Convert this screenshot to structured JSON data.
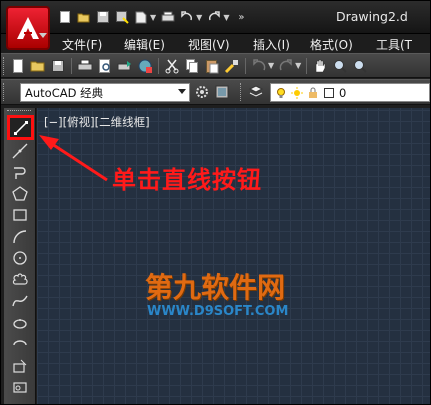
{
  "window": {
    "title": "Drawing2.d",
    "app_logo": "autocad-a-logo"
  },
  "quick_access": [
    "new-icon",
    "open-icon",
    "save-icon",
    "saveas-icon",
    "publish-icon",
    "print-icon",
    "undo-icon",
    "redo-icon",
    "more-icon"
  ],
  "menu": [
    {
      "label": "文件(F)"
    },
    {
      "label": "编辑(E)"
    },
    {
      "label": "视图(V)"
    },
    {
      "label": "插入(I)"
    },
    {
      "label": "格式(O)"
    },
    {
      "label": "工具(T"
    }
  ],
  "toolbar": {
    "workspace": "AutoCAD 经典",
    "layer_value": "0"
  },
  "canvas": {
    "view_label": "[−][俯视][二维线框]",
    "annotation": "单击直线按钮",
    "watermark_cn": "第九软件网",
    "watermark_url": "WWW.D9SOFT.COM"
  },
  "draw_tools": [
    "line",
    "construction-line",
    "polyline",
    "polygon",
    "rectangle",
    "arc",
    "circle",
    "revision-cloud",
    "spline",
    "ellipse",
    "ellipse-arc",
    "insert-block",
    "make-block"
  ],
  "colors": {
    "annotation": "#ff1a1a",
    "canvas_bg": "#243040",
    "highlight_box": "#ff1010"
  }
}
